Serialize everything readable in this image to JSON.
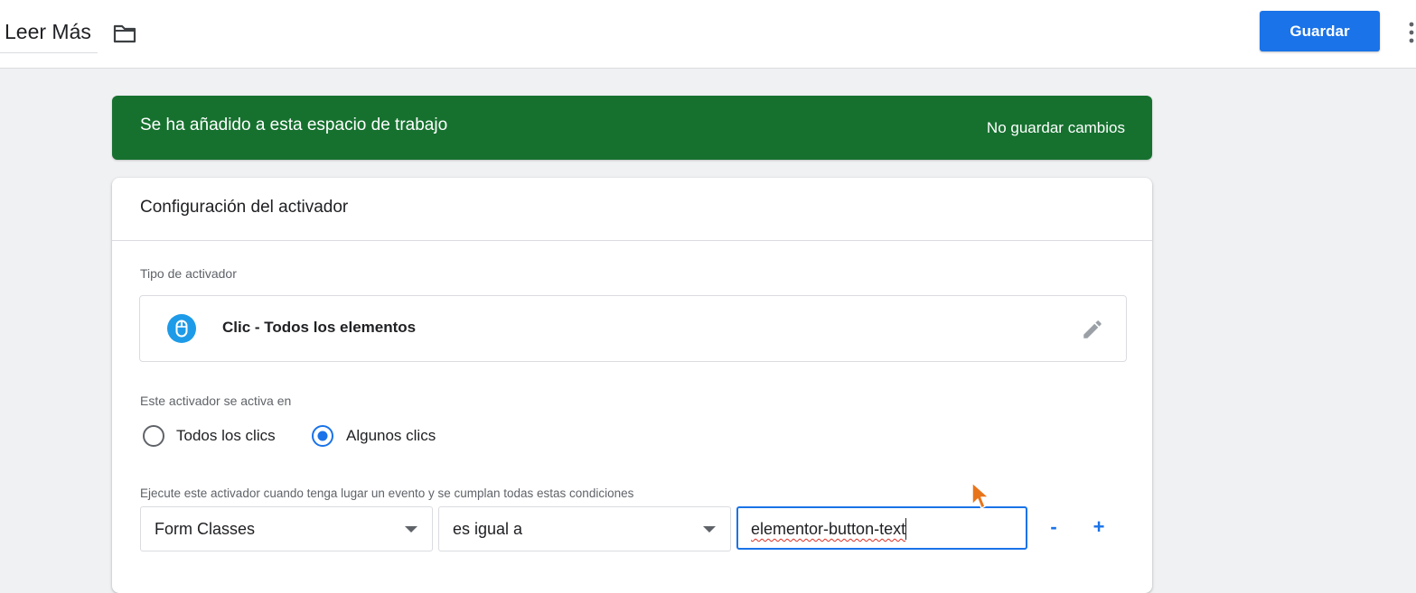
{
  "header": {
    "title": "Leer Más",
    "save_label": "Guardar",
    "icons": [
      "folder-icon",
      "more-vert-icon"
    ]
  },
  "banner": {
    "message": "Se ha añadido a esta espacio de trabajo",
    "action_label": "No guardar cambios",
    "color": "#16712f"
  },
  "card": {
    "title": "Configuración del activador",
    "trigger_type_label": "Tipo de activador",
    "trigger_type_name": "Clic - Todos los elementos",
    "trigger_type_icon": "mouse-icon",
    "fires_on_label": "Este activador se activa en",
    "radios": [
      {
        "label": "Todos los clics",
        "selected": false
      },
      {
        "label": "Algunos clics",
        "selected": true
      }
    ],
    "conditions_label": "Ejecute este activador cuando tenga lugar un evento y se cumplan todas estas condiciones",
    "condition": {
      "variable": "Form Classes",
      "operator": "es igual a",
      "value": "elementor-button-text"
    },
    "remove_label": "-",
    "add_label": "+"
  },
  "colors": {
    "accent": "#1a73e8",
    "banner_green": "#16712f",
    "mouse_icon_blue": "#1e9be8"
  }
}
